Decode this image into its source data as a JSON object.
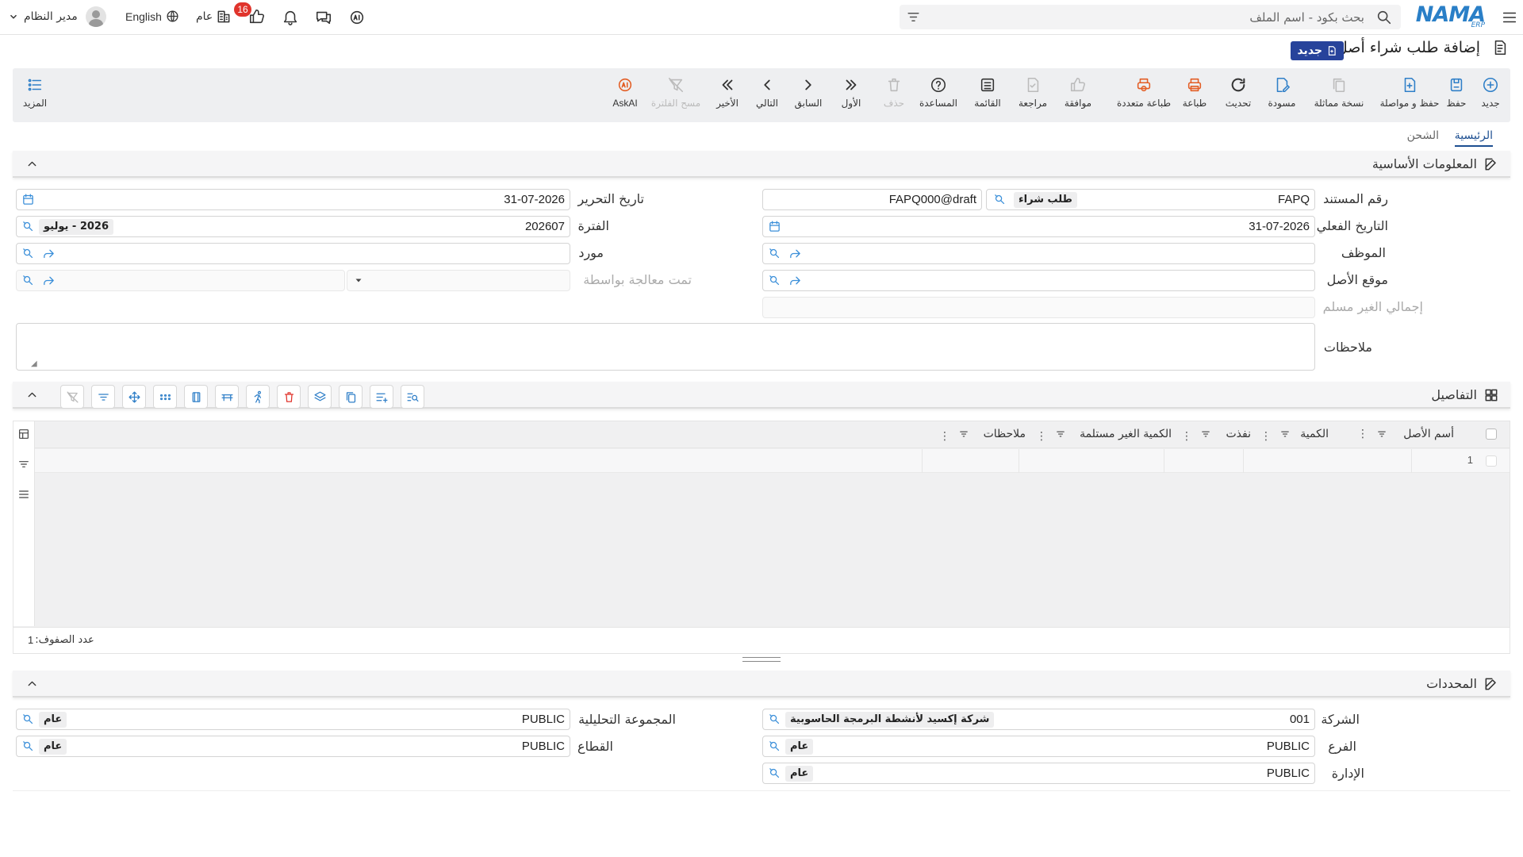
{
  "topbar": {
    "brand": "NAMA",
    "brand_sub": "ERP",
    "search_placeholder": "بحث بكود - اسم الملف",
    "language": "English",
    "user": "مدير النظام",
    "context": "عام",
    "notif_count": "16"
  },
  "page": {
    "title": "إضافة طلب شراء أصل",
    "badge": "جديد"
  },
  "toolbar": {
    "new": "جديد",
    "save": "حفظ",
    "save_continue": "حفظ و مواصلة",
    "copy": "نسخة مماثلة",
    "draft": "مسودة",
    "refresh": "تحديث",
    "print": "طباعة",
    "multi_print": "طباعة متعددة",
    "approve": "موافقة",
    "review": "مراجعة",
    "list": "القائمة",
    "help": "المساعدة",
    "delete": "حذف",
    "first": "الأول",
    "previous": "السابق",
    "next": "التالي",
    "last": "الأخير",
    "clear_filter": "مسح الفلترة",
    "askai": "AskAI",
    "more": "المزيد"
  },
  "tabs": [
    "الرئيسية",
    "الشحن"
  ],
  "sections": {
    "basic": "المعلومات الأساسية",
    "details": "التفاصيل",
    "dimensions": "المحددات"
  },
  "form": {
    "doc_no_label": "رقم المستند",
    "doc_no_value": "FAPQ",
    "doc_type_chip": "طلب شراء",
    "doc_code": "FAPQ000@draft",
    "issue_date_label": "تاريخ التحرير",
    "issue_date_value": "31-07-2026",
    "actual_date_label": "التاريخ الفعلي",
    "actual_date_value": "31-07-2026",
    "period_label": "الفترة",
    "period_value": "202607",
    "period_chip": "2026 - يوليو",
    "employee_label": "الموظف",
    "supplier_label": "مورد",
    "asset_location_label": "موقع الأصل",
    "processed_by_label": "تمت معالجة بواسطة",
    "total_unreceived_label": "إجمالي الغير مسلم",
    "notes_label": "ملاحظات"
  },
  "grid": {
    "columns": [
      "أسم الأصل",
      "الكمية",
      "نفذت",
      "الكمية الغير مستلمة",
      "ملاحظات"
    ],
    "row_number": "1",
    "row_count_label": "عدد الصفوف:",
    "row_count_value": "1"
  },
  "dimensions": {
    "company_label": "الشركة",
    "company_value": "001",
    "company_chip": "شركة إكسيد لأنشطة البرمجة الحاسوبية",
    "branch_label": "الفرع",
    "branch_value": "PUBLIC",
    "branch_chip": "عام",
    "department_label": "الإدارة",
    "department_value": "PUBLIC",
    "department_chip": "عام",
    "analytic_label": "المجموعة التحليلية",
    "analytic_value": "PUBLIC",
    "analytic_chip": "عام",
    "sector_label": "القطاع",
    "sector_value": "PUBLIC",
    "sector_chip": "عام"
  }
}
